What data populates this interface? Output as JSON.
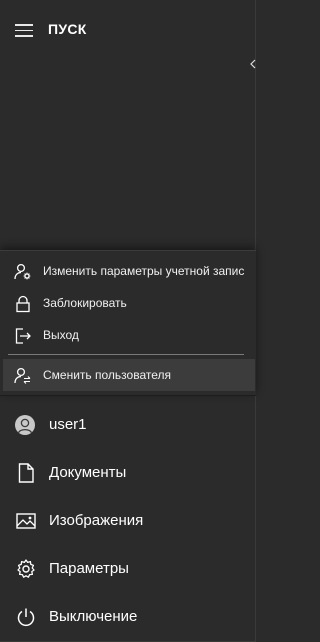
{
  "header": {
    "title": "ПУСК",
    "menu_icon": "hamburger-icon"
  },
  "account_menu": {
    "items": [
      {
        "label": "Изменить параметры учетной запис",
        "icon": "user-settings-icon"
      },
      {
        "label": "Заблокировать",
        "icon": "lock-icon"
      },
      {
        "label": "Выход",
        "icon": "sign-out-icon"
      },
      {
        "label": "Сменить пользователя",
        "icon": "switch-user-icon"
      }
    ]
  },
  "nav": {
    "user": {
      "label": "user1",
      "icon": "avatar-icon"
    },
    "items": [
      {
        "label": "Документы",
        "icon": "document-icon"
      },
      {
        "label": "Изображения",
        "icon": "pictures-icon"
      },
      {
        "label": "Параметры",
        "icon": "gear-icon"
      },
      {
        "label": "Выключение",
        "icon": "power-icon"
      }
    ]
  }
}
